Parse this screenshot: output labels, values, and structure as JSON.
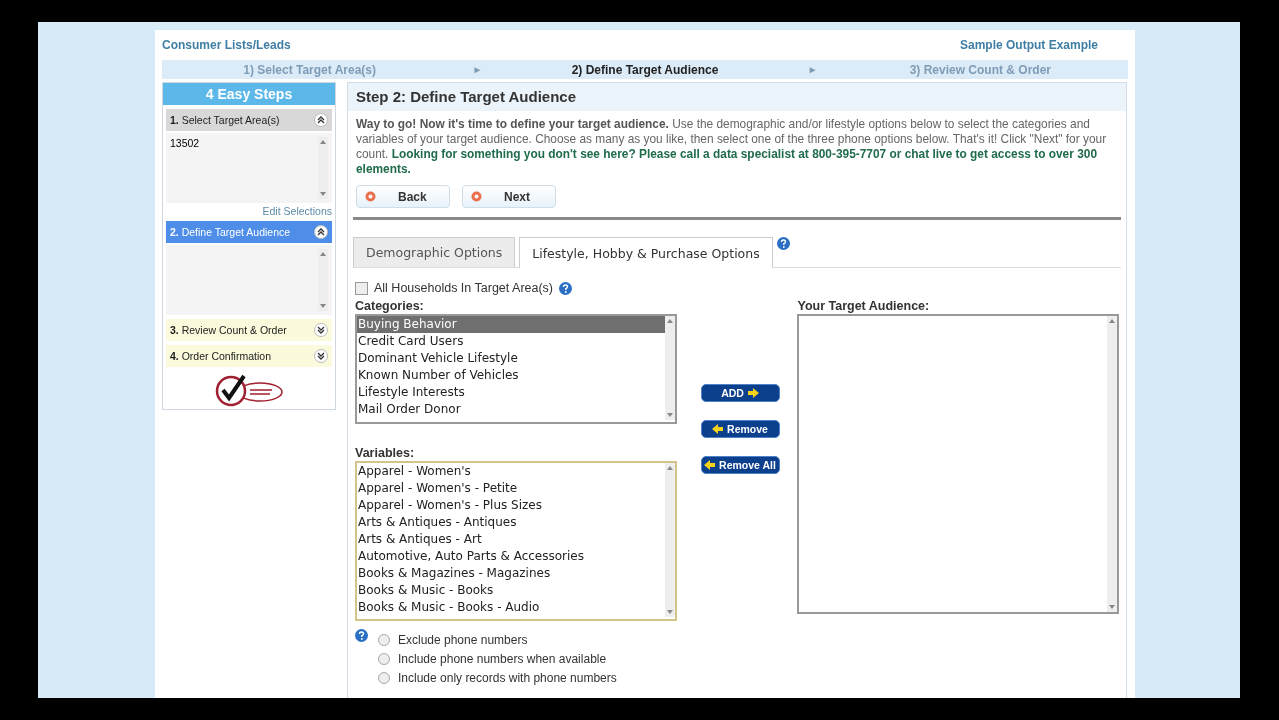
{
  "header": {
    "title": "Consumer Lists/Leads",
    "link": "Sample Output Example"
  },
  "progress": [
    {
      "label": "1) Select Target Area(s)",
      "selected": false,
      "arrow": "►"
    },
    {
      "label": "2) Define Target Audience",
      "selected": true,
      "arrow": "►"
    },
    {
      "label": "3) Review Count & Order",
      "selected": false
    }
  ],
  "sidebar": {
    "title": "4 Easy Steps",
    "sections": [
      {
        "number": "1.",
        "label": "Select Target Area(s)",
        "expanded": true,
        "selected": false,
        "items": [
          "13502"
        ],
        "link": "Edit Selections"
      },
      {
        "number": "2.",
        "label": "Define Target Audience",
        "expanded": true,
        "selected": true
      },
      {
        "number": "3.",
        "label": "Review Count & Order",
        "expanded": false,
        "selected": false
      },
      {
        "number": "4.",
        "label": "Order Confirmation",
        "expanded": false,
        "selected": false
      }
    ]
  },
  "main": {
    "title": "Step 2: Define Target Audience",
    "intro": [
      {
        "kind": "bold",
        "text": "Way to go! Now it's time to define your target audience."
      },
      {
        "kind": "plain",
        "text": " Use the demographic and/or lifestyle options below to select the categories and variables of your target audience. Choose as many as you like, then select one of the three phone options below. That's it! Click \"Next\" for your count. "
      },
      {
        "kind": "highlight",
        "text": "Looking for something you don't see here? Please call a data specialist at 800-395-7707 or chat live to get access to over 300 elements."
      }
    ],
    "buttons": [
      {
        "label": "Back"
      },
      {
        "label": "Next"
      }
    ],
    "tabs": [
      {
        "label": "Demographic Options",
        "selected": false
      },
      {
        "label": "Lifestyle, Hobby & Purchase Options",
        "selected": true
      }
    ],
    "all_households": {
      "label": "All Households In Target Area(s)",
      "checked": false
    },
    "categories": {
      "label": "Categories:",
      "items": [
        {
          "label": "Buying Behavior",
          "selected": true
        },
        {
          "label": "Credit Card Users",
          "selected": false
        },
        {
          "label": "Dominant Vehicle Lifestyle",
          "selected": false
        },
        {
          "label": "Known Number of Vehicles",
          "selected": false
        },
        {
          "label": "Lifestyle Interests",
          "selected": false
        },
        {
          "label": "Mail Order Donor",
          "selected": false
        }
      ]
    },
    "variables": {
      "label": "Variables:",
      "items": [
        {
          "label": "Apparel - Women's",
          "selected": false
        },
        {
          "label": "Apparel - Women's - Petite",
          "selected": false
        },
        {
          "label": "Apparel - Women's - Plus Sizes",
          "selected": false
        },
        {
          "label": "Arts & Antiques - Antiques",
          "selected": false
        },
        {
          "label": "Arts & Antiques - Art",
          "selected": false
        },
        {
          "label": "Automotive, Auto Parts & Accessories",
          "selected": false
        },
        {
          "label": "Books & Magazines - Magazines",
          "selected": false
        },
        {
          "label": "Books & Music - Books",
          "selected": false
        },
        {
          "label": "Books & Music - Books - Audio",
          "selected": false
        }
      ]
    },
    "transfer_buttons": [
      {
        "label": "ADD",
        "kind": "forward"
      },
      {
        "label": "Remove",
        "kind": "back"
      },
      {
        "label": "Remove All",
        "kind": "back"
      }
    ],
    "target": {
      "label": "Your Target Audience:"
    },
    "phone_options": [
      {
        "label": "Exclude phone numbers",
        "selected": false
      },
      {
        "label": "Include phone numbers when available",
        "selected": false
      },
      {
        "label": "Include only records with phone numbers",
        "selected": false
      }
    ]
  }
}
